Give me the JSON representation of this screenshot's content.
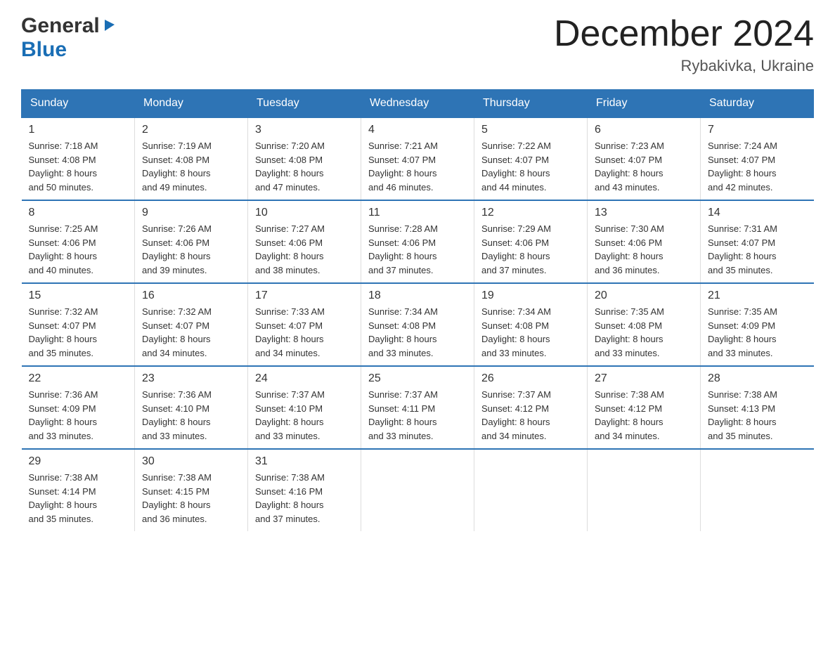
{
  "logo": {
    "general": "General",
    "blue": "Blue",
    "triangle": "▶"
  },
  "title": "December 2024",
  "location": "Rybakivka, Ukraine",
  "days_of_week": [
    "Sunday",
    "Monday",
    "Tuesday",
    "Wednesday",
    "Thursday",
    "Friday",
    "Saturday"
  ],
  "weeks": [
    [
      {
        "day": "1",
        "sunrise": "7:18 AM",
        "sunset": "4:08 PM",
        "daylight": "8 hours and 50 minutes."
      },
      {
        "day": "2",
        "sunrise": "7:19 AM",
        "sunset": "4:08 PM",
        "daylight": "8 hours and 49 minutes."
      },
      {
        "day": "3",
        "sunrise": "7:20 AM",
        "sunset": "4:08 PM",
        "daylight": "8 hours and 47 minutes."
      },
      {
        "day": "4",
        "sunrise": "7:21 AM",
        "sunset": "4:07 PM",
        "daylight": "8 hours and 46 minutes."
      },
      {
        "day": "5",
        "sunrise": "7:22 AM",
        "sunset": "4:07 PM",
        "daylight": "8 hours and 44 minutes."
      },
      {
        "day": "6",
        "sunrise": "7:23 AM",
        "sunset": "4:07 PM",
        "daylight": "8 hours and 43 minutes."
      },
      {
        "day": "7",
        "sunrise": "7:24 AM",
        "sunset": "4:07 PM",
        "daylight": "8 hours and 42 minutes."
      }
    ],
    [
      {
        "day": "8",
        "sunrise": "7:25 AM",
        "sunset": "4:06 PM",
        "daylight": "8 hours and 40 minutes."
      },
      {
        "day": "9",
        "sunrise": "7:26 AM",
        "sunset": "4:06 PM",
        "daylight": "8 hours and 39 minutes."
      },
      {
        "day": "10",
        "sunrise": "7:27 AM",
        "sunset": "4:06 PM",
        "daylight": "8 hours and 38 minutes."
      },
      {
        "day": "11",
        "sunrise": "7:28 AM",
        "sunset": "4:06 PM",
        "daylight": "8 hours and 37 minutes."
      },
      {
        "day": "12",
        "sunrise": "7:29 AM",
        "sunset": "4:06 PM",
        "daylight": "8 hours and 37 minutes."
      },
      {
        "day": "13",
        "sunrise": "7:30 AM",
        "sunset": "4:06 PM",
        "daylight": "8 hours and 36 minutes."
      },
      {
        "day": "14",
        "sunrise": "7:31 AM",
        "sunset": "4:07 PM",
        "daylight": "8 hours and 35 minutes."
      }
    ],
    [
      {
        "day": "15",
        "sunrise": "7:32 AM",
        "sunset": "4:07 PM",
        "daylight": "8 hours and 35 minutes."
      },
      {
        "day": "16",
        "sunrise": "7:32 AM",
        "sunset": "4:07 PM",
        "daylight": "8 hours and 34 minutes."
      },
      {
        "day": "17",
        "sunrise": "7:33 AM",
        "sunset": "4:07 PM",
        "daylight": "8 hours and 34 minutes."
      },
      {
        "day": "18",
        "sunrise": "7:34 AM",
        "sunset": "4:08 PM",
        "daylight": "8 hours and 33 minutes."
      },
      {
        "day": "19",
        "sunrise": "7:34 AM",
        "sunset": "4:08 PM",
        "daylight": "8 hours and 33 minutes."
      },
      {
        "day": "20",
        "sunrise": "7:35 AM",
        "sunset": "4:08 PM",
        "daylight": "8 hours and 33 minutes."
      },
      {
        "day": "21",
        "sunrise": "7:35 AM",
        "sunset": "4:09 PM",
        "daylight": "8 hours and 33 minutes."
      }
    ],
    [
      {
        "day": "22",
        "sunrise": "7:36 AM",
        "sunset": "4:09 PM",
        "daylight": "8 hours and 33 minutes."
      },
      {
        "day": "23",
        "sunrise": "7:36 AM",
        "sunset": "4:10 PM",
        "daylight": "8 hours and 33 minutes."
      },
      {
        "day": "24",
        "sunrise": "7:37 AM",
        "sunset": "4:10 PM",
        "daylight": "8 hours and 33 minutes."
      },
      {
        "day": "25",
        "sunrise": "7:37 AM",
        "sunset": "4:11 PM",
        "daylight": "8 hours and 33 minutes."
      },
      {
        "day": "26",
        "sunrise": "7:37 AM",
        "sunset": "4:12 PM",
        "daylight": "8 hours and 34 minutes."
      },
      {
        "day": "27",
        "sunrise": "7:38 AM",
        "sunset": "4:12 PM",
        "daylight": "8 hours and 34 minutes."
      },
      {
        "day": "28",
        "sunrise": "7:38 AM",
        "sunset": "4:13 PM",
        "daylight": "8 hours and 35 minutes."
      }
    ],
    [
      {
        "day": "29",
        "sunrise": "7:38 AM",
        "sunset": "4:14 PM",
        "daylight": "8 hours and 35 minutes."
      },
      {
        "day": "30",
        "sunrise": "7:38 AM",
        "sunset": "4:15 PM",
        "daylight": "8 hours and 36 minutes."
      },
      {
        "day": "31",
        "sunrise": "7:38 AM",
        "sunset": "4:16 PM",
        "daylight": "8 hours and 37 minutes."
      },
      null,
      null,
      null,
      null
    ]
  ],
  "labels": {
    "sunrise_prefix": "Sunrise: ",
    "sunset_prefix": "Sunset: ",
    "daylight_prefix": "Daylight: "
  }
}
